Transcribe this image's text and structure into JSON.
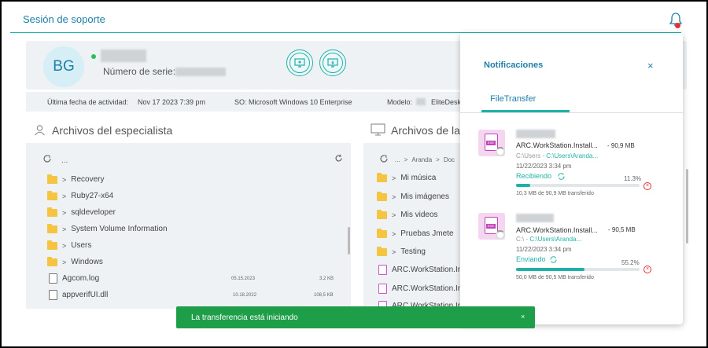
{
  "header": {
    "title": "Sesión de soporte"
  },
  "device": {
    "initials": "BG",
    "serial_label": "Número de serie:"
  },
  "info_bar": {
    "last_activity_label": "Última fecha de actividad:",
    "last_activity_value": "Nov 17 2023 7:39 pm",
    "os_label": "SO:",
    "os_value": "Microsoft Windows 10 Enterprise",
    "model_label": "Modelo:",
    "model_value": "EliteDesk"
  },
  "specialist_panel": {
    "title": "Archivos del especialista",
    "path": "...",
    "items": [
      {
        "type": "folder",
        "name": "Recovery"
      },
      {
        "type": "folder",
        "name": "Ruby27-x64"
      },
      {
        "type": "folder",
        "name": "sqldeveloper"
      },
      {
        "type": "folder",
        "name": "System Volume Information"
      },
      {
        "type": "folder",
        "name": "Users"
      },
      {
        "type": "folder",
        "name": "Windows"
      },
      {
        "type": "file",
        "name": "Agcom.log",
        "date": "05.15.2023",
        "size": "3,2 KB"
      },
      {
        "type": "file",
        "name": "appverifUI.dll",
        "date": "10.18.2022",
        "size": "108,5 KB"
      }
    ]
  },
  "device_panel": {
    "title": "Archivos de la c",
    "breadcrumb": [
      "...",
      "Aranda",
      "Doc"
    ],
    "items": [
      {
        "type": "folder",
        "name": "Mi música"
      },
      {
        "type": "folder",
        "name": "Mis imágenes"
      },
      {
        "type": "folder",
        "name": "Mis videos"
      },
      {
        "type": "folder",
        "name": "Pruebas Jmete"
      },
      {
        "type": "folder",
        "name": "Testing"
      },
      {
        "type": "file",
        "name": "ARC.WorkStation.In"
      },
      {
        "type": "file",
        "name": "ARC.WorkStation.In"
      },
      {
        "type": "file",
        "name": "ARC.WorkStation.In"
      }
    ]
  },
  "notifications": {
    "title": "Notificaciones",
    "close": "×",
    "tab": "FileTransfer",
    "transfers": [
      {
        "name": "ARC.WorkStation.Install...",
        "size": "- 90,9 MB",
        "path_prefix": "C:\\Users - ",
        "path_link": "C:\\Users\\Aranda...",
        "date": "11/22/2023 3:34 pm",
        "status": "Recibiendo",
        "percent_label": "11.3%",
        "progress": 0.113,
        "detail": "10,3 MB de 90,9 MB transferido",
        "icon_label": "EXE"
      },
      {
        "name": "ARC.WorkStation.Install...",
        "size": "- 90,5 MB",
        "path_prefix": "C:\\ - ",
        "path_link": "C:\\Users\\Aranda...",
        "date": "11/22/2023 3:34 pm",
        "status": "Enviando",
        "percent_label": "55.2%",
        "progress": 0.552,
        "detail": "50,0 MB de 90,5 MB transferido",
        "icon_label": "EXE"
      }
    ]
  },
  "toast": {
    "message": "La transferencia está iniciando",
    "close": "×"
  },
  "colors": {
    "accent": "#1fb1a8",
    "brand_blue": "#1d7fa7",
    "toast": "#1e9e48",
    "error": "#e03232"
  }
}
